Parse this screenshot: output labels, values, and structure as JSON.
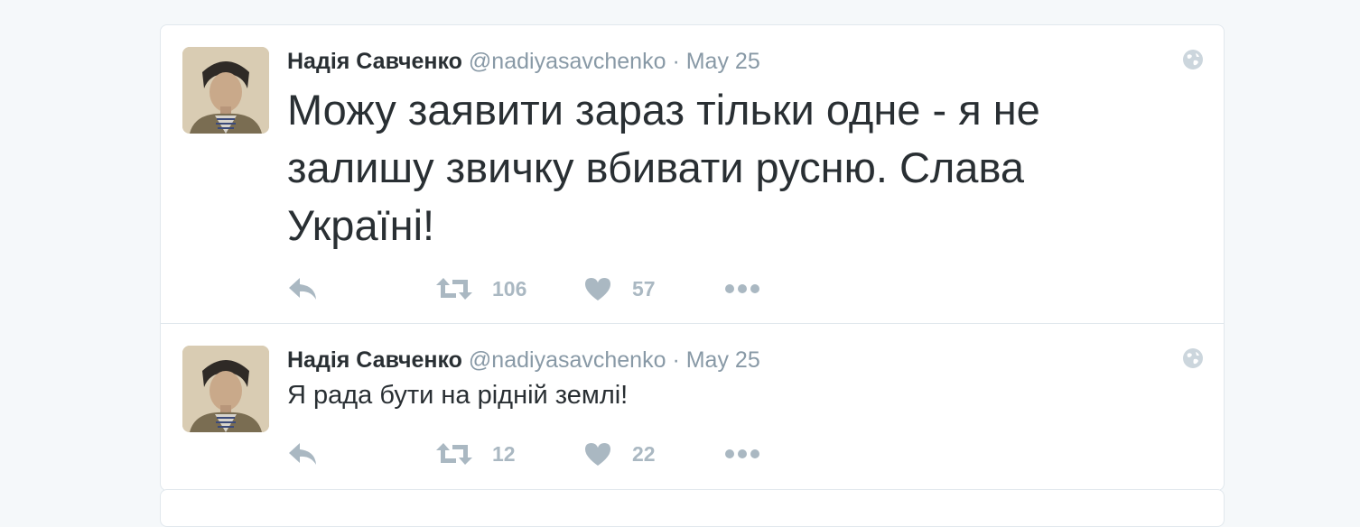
{
  "colors": {
    "background": "#f5f8fa",
    "card": "#ffffff",
    "border": "#e1e8ed",
    "text": "#292f33",
    "muted": "#8899a6",
    "icon": "#aab8c2"
  },
  "tweets": [
    {
      "display_name": "Надія Савченко",
      "handle": "@nadiyasavchenko",
      "separator": "·",
      "date": "May 25",
      "text": "Можу заявити зараз тільки одне - я не залишу звичку вбивати русню. Слава Україні!",
      "retweets": "106",
      "likes": "57",
      "icons": [
        "avatar",
        "globe-icon",
        "reply-icon",
        "retweet-icon",
        "heart-icon",
        "more-icon"
      ]
    },
    {
      "display_name": "Надія Савченко",
      "handle": "@nadiyasavchenko",
      "separator": "·",
      "date": "May 25",
      "text": "Я рада бути на рідній землі!",
      "retweets": "12",
      "likes": "22",
      "icons": [
        "avatar",
        "globe-icon",
        "reply-icon",
        "retweet-icon",
        "heart-icon",
        "more-icon"
      ]
    }
  ]
}
